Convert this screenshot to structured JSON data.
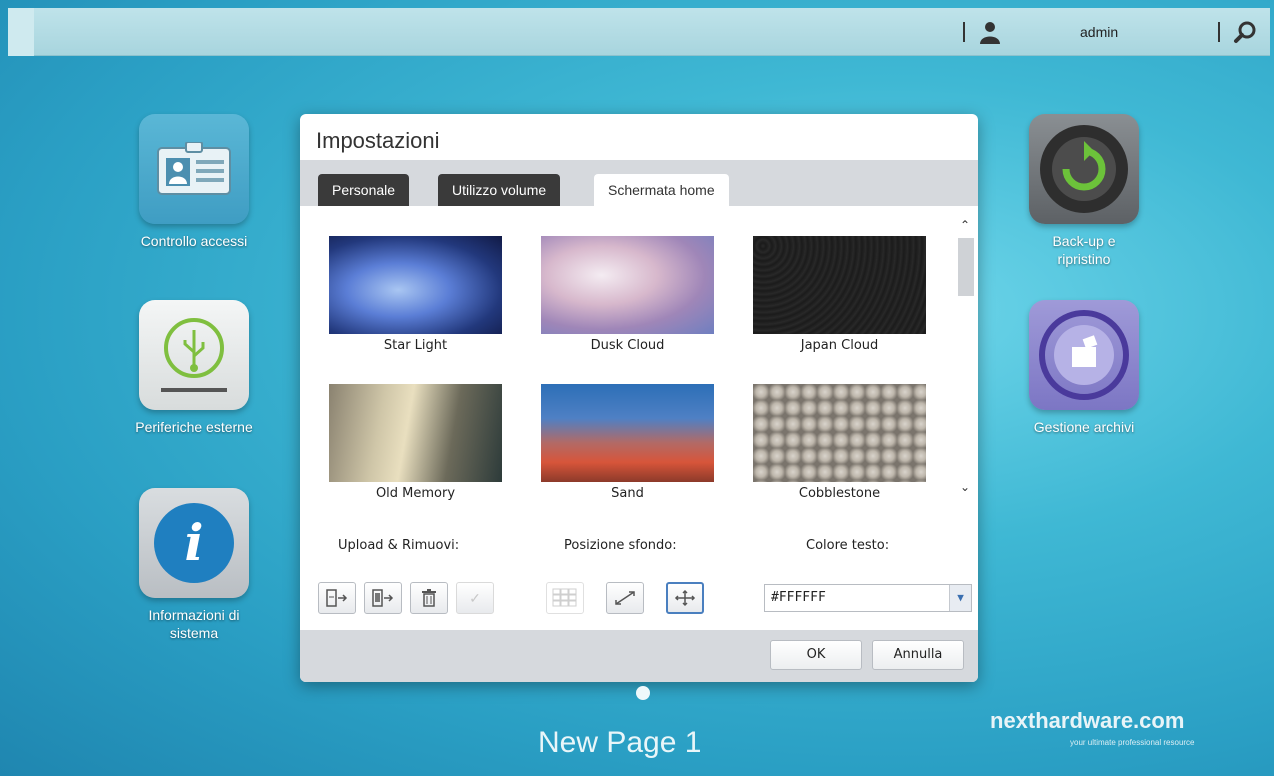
{
  "topbar": {
    "username": "admin"
  },
  "desktop": {
    "left_icons": [
      {
        "label": "Controllo accessi",
        "icon": "id-card-icon"
      },
      {
        "label": "Periferiche esterne",
        "icon": "usb-drive-icon"
      },
      {
        "label": "Informazioni di sistema",
        "icon": "info-icon"
      }
    ],
    "right_icons": [
      {
        "label": "Back-up e ripristino",
        "icon": "backup-restore-icon"
      },
      {
        "label": "Gestione archivi",
        "icon": "archive-manager-icon"
      }
    ],
    "page_title": "New Page 1"
  },
  "dialog": {
    "title": "Impostazioni",
    "tabs": [
      {
        "label": "Personale"
      },
      {
        "label": "Utilizzo volume"
      },
      {
        "label": "Schermata home",
        "active": true
      }
    ],
    "wallpapers": [
      {
        "name": "Star Light"
      },
      {
        "name": "Dusk Cloud"
      },
      {
        "name": "Japan Cloud"
      },
      {
        "name": "Old Memory"
      },
      {
        "name": "Sand"
      },
      {
        "name": "Cobblestone"
      }
    ],
    "upload_label": "Upload & Rimuovi:",
    "position_label": "Posizione sfondo:",
    "text_color_label": "Colore testo:",
    "text_color_value": "#FFFFFF",
    "ok_label": "OK",
    "cancel_label": "Annulla"
  },
  "watermark": {
    "brand": "nexthardware.com",
    "tagline": "your ultimate professional resource"
  }
}
